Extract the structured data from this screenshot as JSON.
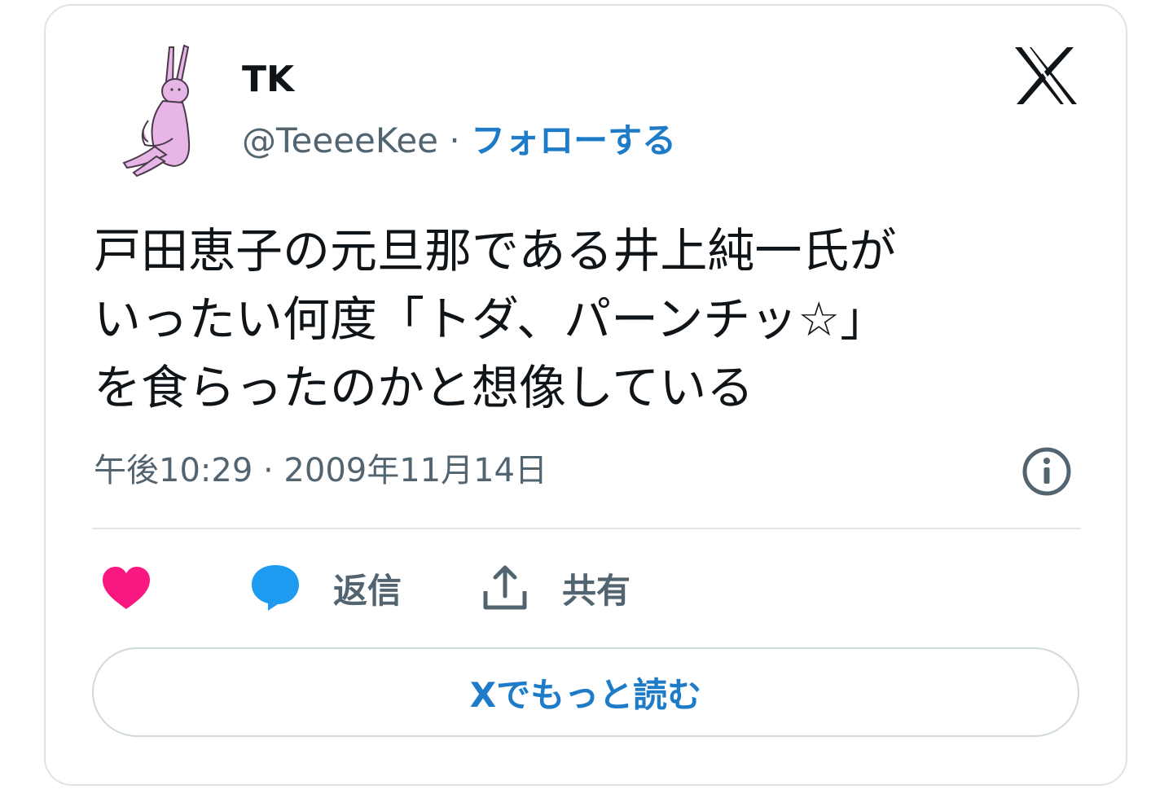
{
  "author": {
    "name": "TK",
    "handle": "@TeeeeKee",
    "separator": " · ",
    "follow_label": "フォローする"
  },
  "tweet": {
    "lines": [
      "戸田恵子の元旦那である井上純一氏が",
      "いったい何度「トダ、パーンチッ☆」",
      "を食らったのかと想像している"
    ]
  },
  "meta": {
    "timestamp": "午後10:29 · 2009年11月14日"
  },
  "actions": {
    "reply_label": "返信",
    "share_label": "共有"
  },
  "readmore": {
    "label": "Xでもっと読む"
  },
  "icons": {
    "like": "heart-icon",
    "reply": "speech-bubble-icon",
    "share": "share-upload-icon",
    "info": "info-icon",
    "brand": "x-logo-icon"
  },
  "colors": {
    "like": "#f91880",
    "reply": "#1d9bf0",
    "link": "#1d7bc8",
    "text": "#0f1419",
    "muted": "#536471"
  }
}
